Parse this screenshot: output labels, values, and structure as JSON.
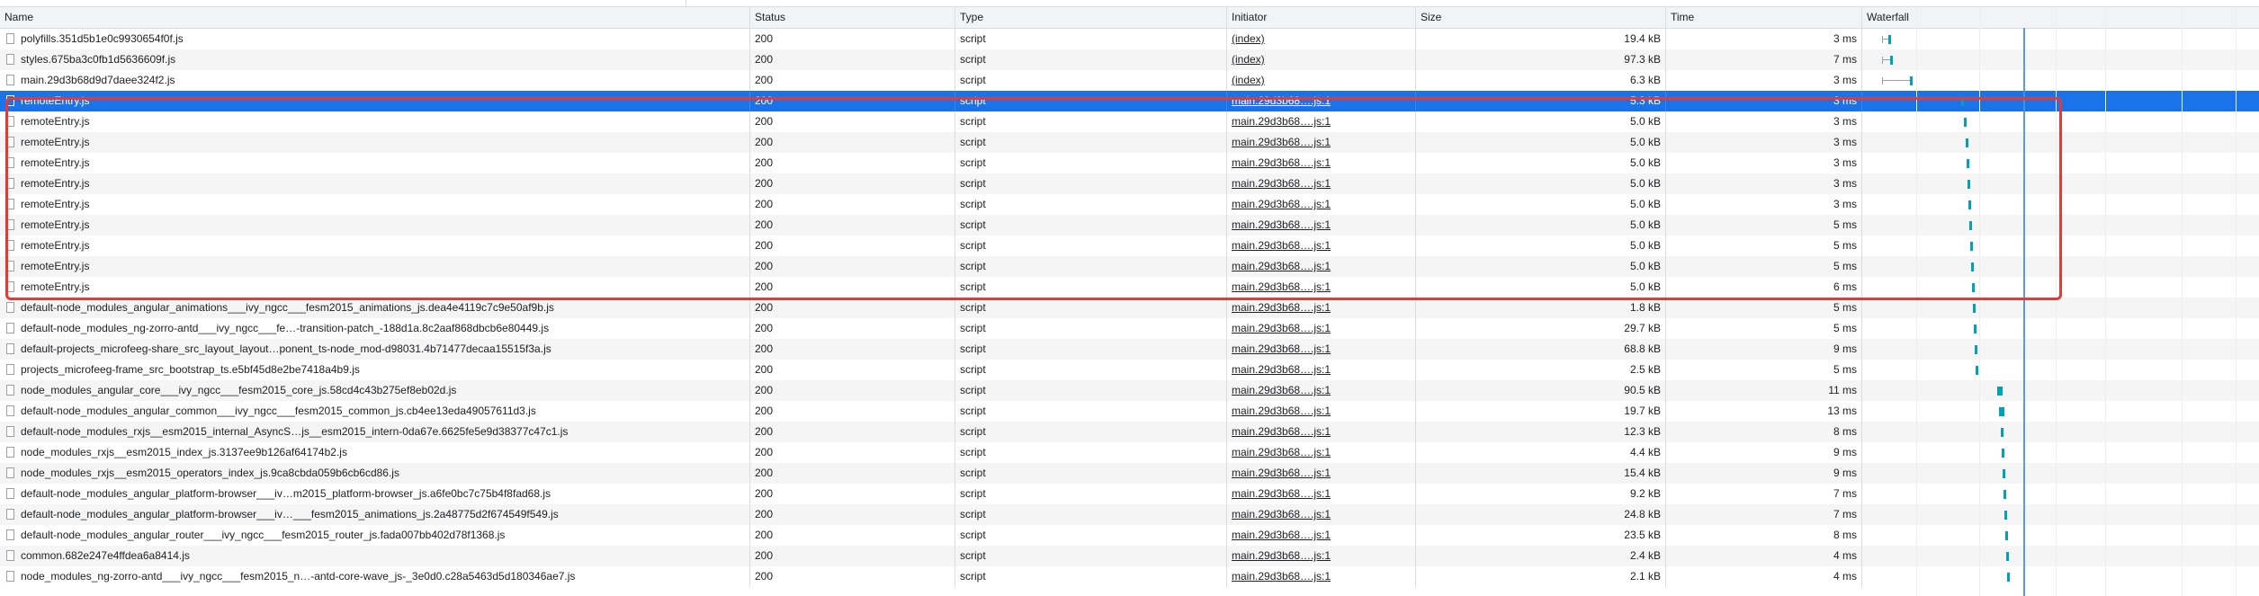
{
  "columns": {
    "name": "Name",
    "status": "Status",
    "type": "Type",
    "initiator": "Initiator",
    "size": "Size",
    "time": "Time",
    "waterfall": "Waterfall"
  },
  "colors": {
    "selected_row": "#1a73e8",
    "highlight_box": "#e53935",
    "waterfall_receive": "#00a2b8"
  },
  "selected_row_index": 3,
  "highlighted_rows": [
    3,
    4,
    5,
    6,
    7,
    8,
    9,
    10,
    11,
    12
  ],
  "rows": [
    {
      "name": "polyfills.351d5b1e0c9930654f0f.js",
      "status": "200",
      "type": "script",
      "initiator": "(index)",
      "size": "19.4 kB",
      "time": "3 ms",
      "wf_start": 0.05,
      "wf_recv": 0.065
    },
    {
      "name": "styles.675ba3c0fb1d5636609f.js",
      "status": "200",
      "type": "script",
      "initiator": "(index)",
      "size": "97.3 kB",
      "time": "7 ms",
      "wf_start": 0.05,
      "wf_recv": 0.07
    },
    {
      "name": "main.29d3b68d9d7daee324f2.js",
      "status": "200",
      "type": "script",
      "initiator": "(index)",
      "size": "6.3 kB",
      "time": "3 ms",
      "wf_start": 0.05,
      "wf_recv": 0.12
    },
    {
      "name": "remoteEntry.js",
      "status": "200",
      "type": "script",
      "initiator": "main.29d3b68….js:1",
      "size": "5.3 kB",
      "time": "3 ms",
      "wf_start": 0.25,
      "wf_recv": 0.25
    },
    {
      "name": "remoteEntry.js",
      "status": "200",
      "type": "script",
      "initiator": "main.29d3b68….js:1",
      "size": "5.0 kB",
      "time": "3 ms",
      "wf_start": 0.256,
      "wf_recv": 0.256
    },
    {
      "name": "remoteEntry.js",
      "status": "200",
      "type": "script",
      "initiator": "main.29d3b68….js:1",
      "size": "5.0 kB",
      "time": "3 ms",
      "wf_start": 0.26,
      "wf_recv": 0.26
    },
    {
      "name": "remoteEntry.js",
      "status": "200",
      "type": "script",
      "initiator": "main.29d3b68….js:1",
      "size": "5.0 kB",
      "time": "3 ms",
      "wf_start": 0.264,
      "wf_recv": 0.264
    },
    {
      "name": "remoteEntry.js",
      "status": "200",
      "type": "script",
      "initiator": "main.29d3b68….js:1",
      "size": "5.0 kB",
      "time": "3 ms",
      "wf_start": 0.266,
      "wf_recv": 0.266
    },
    {
      "name": "remoteEntry.js",
      "status": "200",
      "type": "script",
      "initiator": "main.29d3b68….js:1",
      "size": "5.0 kB",
      "time": "3 ms",
      "wf_start": 0.268,
      "wf_recv": 0.268
    },
    {
      "name": "remoteEntry.js",
      "status": "200",
      "type": "script",
      "initiator": "main.29d3b68….js:1",
      "size": "5.0 kB",
      "time": "5 ms",
      "wf_start": 0.27,
      "wf_recv": 0.27
    },
    {
      "name": "remoteEntry.js",
      "status": "200",
      "type": "script",
      "initiator": "main.29d3b68….js:1",
      "size": "5.0 kB",
      "time": "5 ms",
      "wf_start": 0.272,
      "wf_recv": 0.272
    },
    {
      "name": "remoteEntry.js",
      "status": "200",
      "type": "script",
      "initiator": "main.29d3b68….js:1",
      "size": "5.0 kB",
      "time": "5 ms",
      "wf_start": 0.274,
      "wf_recv": 0.274
    },
    {
      "name": "remoteEntry.js",
      "status": "200",
      "type": "script",
      "initiator": "main.29d3b68….js:1",
      "size": "5.0 kB",
      "time": "6 ms",
      "wf_start": 0.276,
      "wf_recv": 0.276
    },
    {
      "name": "default-node_modules_angular_animations___ivy_ngcc___fesm2015_animations_js.dea4e4119c7c9e50af9b.js",
      "status": "200",
      "type": "script",
      "initiator": "main.29d3b68….js:1",
      "size": "1.8 kB",
      "time": "5 ms",
      "wf_start": 0.28,
      "wf_recv": 0.28
    },
    {
      "name": "default-node_modules_ng-zorro-antd___ivy_ngcc___fe…-transition-patch_-188d1a.8c2aaf868dbcb6e80449.js",
      "status": "200",
      "type": "script",
      "initiator": "main.29d3b68….js:1",
      "size": "29.7 kB",
      "time": "5 ms",
      "wf_start": 0.282,
      "wf_recv": 0.282
    },
    {
      "name": "default-projects_microfeeg-share_src_layout_layout…ponent_ts-node_mod-d98031.4b71477decaa15515f3a.js",
      "status": "200",
      "type": "script",
      "initiator": "main.29d3b68….js:1",
      "size": "68.8 kB",
      "time": "9 ms",
      "wf_start": 0.284,
      "wf_recv": 0.284
    },
    {
      "name": "projects_microfeeg-frame_src_bootstrap_ts.e5bf45d8e2be7418a4b9.js",
      "status": "200",
      "type": "script",
      "initiator": "main.29d3b68….js:1",
      "size": "2.5 kB",
      "time": "5 ms",
      "wf_start": 0.286,
      "wf_recv": 0.286
    },
    {
      "name": "node_modules_angular_core___ivy_ngcc___fesm2015_core_js.58cd4c43b275ef8eb02d.js",
      "status": "200",
      "type": "script",
      "initiator": "main.29d3b68….js:1",
      "size": "90.5 kB",
      "time": "11 ms",
      "wf_start": 0.34,
      "wf_recv": 0.34
    },
    {
      "name": "default-node_modules_angular_common___ivy_ngcc___fesm2015_common_js.cb4ee13eda49057611d3.js",
      "status": "200",
      "type": "script",
      "initiator": "main.29d3b68….js:1",
      "size": "19.7 kB",
      "time": "13 ms",
      "wf_start": 0.345,
      "wf_recv": 0.345
    },
    {
      "name": "default-node_modules_rxjs__esm2015_internal_AsyncS…js__esm2015_intern-0da67e.6625fe5e9d38377c47c1.js",
      "status": "200",
      "type": "script",
      "initiator": "main.29d3b68….js:1",
      "size": "12.3 kB",
      "time": "8 ms",
      "wf_start": 0.35,
      "wf_recv": 0.35
    },
    {
      "name": "node_modules_rxjs__esm2015_index_js.3137ee9b126af64174b2.js",
      "status": "200",
      "type": "script",
      "initiator": "main.29d3b68….js:1",
      "size": "4.4 kB",
      "time": "9 ms",
      "wf_start": 0.352,
      "wf_recv": 0.352
    },
    {
      "name": "node_modules_rxjs__esm2015_operators_index_js.9ca8cbda059b6cb6cd86.js",
      "status": "200",
      "type": "script",
      "initiator": "main.29d3b68….js:1",
      "size": "15.4 kB",
      "time": "9 ms",
      "wf_start": 0.354,
      "wf_recv": 0.354
    },
    {
      "name": "default-node_modules_angular_platform-browser___iv…m2015_platform-browser_js.a6fe0bc7c75b4f8fad68.js",
      "status": "200",
      "type": "script",
      "initiator": "main.29d3b68….js:1",
      "size": "9.2 kB",
      "time": "7 ms",
      "wf_start": 0.356,
      "wf_recv": 0.356
    },
    {
      "name": "default-node_modules_angular_platform-browser___iv…___fesm2015_animations_js.2a48775d2f674549f549.js",
      "status": "200",
      "type": "script",
      "initiator": "main.29d3b68….js:1",
      "size": "24.8 kB",
      "time": "7 ms",
      "wf_start": 0.358,
      "wf_recv": 0.358
    },
    {
      "name": "default-node_modules_angular_router___ivy_ngcc___fesm2015_router_js.fada007bb402d78f1368.js",
      "status": "200",
      "type": "script",
      "initiator": "main.29d3b68….js:1",
      "size": "23.5 kB",
      "time": "8 ms",
      "wf_start": 0.36,
      "wf_recv": 0.36
    },
    {
      "name": "common.682e247e4ffdea6a8414.js",
      "status": "200",
      "type": "script",
      "initiator": "main.29d3b68….js:1",
      "size": "2.4 kB",
      "time": "4 ms",
      "wf_start": 0.362,
      "wf_recv": 0.362
    },
    {
      "name": "node_modules_ng-zorro-antd___ivy_ngcc___fesm2015_n…-antd-core-wave_js-_3e0d0.c28a5463d5d180346ae7.js",
      "status": "200",
      "type": "script",
      "initiator": "main.29d3b68….js:1",
      "size": "2.1 kB",
      "time": "4 ms",
      "wf_start": 0.364,
      "wf_recv": 0.364
    }
  ]
}
